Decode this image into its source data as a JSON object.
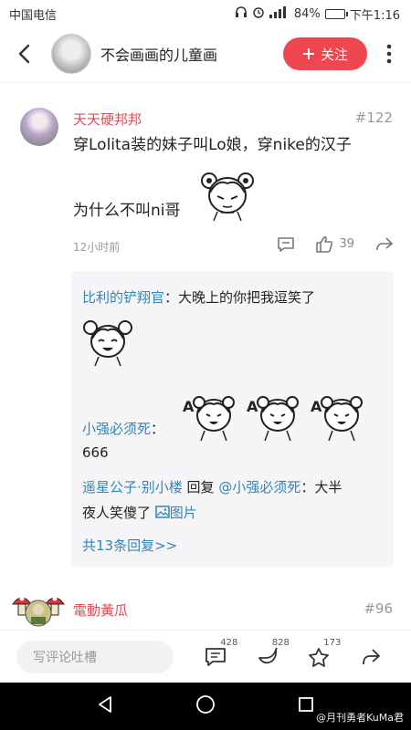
{
  "status": {
    "carrier": "中国电信",
    "battery": "84%",
    "battery_level": 0.84,
    "time": "下午1:16"
  },
  "topbar": {
    "channel_title": "不会画画的儿童画",
    "follow_label": "关注"
  },
  "comment": {
    "username": "天天硬邦邦",
    "floor": "#122",
    "text_line1": "穿Lolita装的妹子叫Lo娘，穿nike的汉子",
    "text_line2": "为什么不叫ni哥",
    "time": "12小时前",
    "likes": "39"
  },
  "replies": {
    "r1_user": "比利的铲翔官",
    "r1_text": "：大晚上的你把我逗笑了",
    "r2_user": "小强必须死",
    "r2_sep": "：",
    "r2_text": "666",
    "r3_user": "遥星公子·别小楼",
    "r3_mid": " 回复 ",
    "r3_target": "@小强必须死",
    "r3_text1": "：大半",
    "r3_text2": "夜人笑傻了",
    "r3_image_link": "图片",
    "more_link": "共13条回复>>"
  },
  "comment2": {
    "username": "電動黃瓜",
    "floor": "#96"
  },
  "input": {
    "placeholder": "写评论吐槽",
    "comments_count": "428",
    "share_count": "828",
    "favorite_count": "173"
  },
  "watermark": "@月刊勇者KuMa君"
}
